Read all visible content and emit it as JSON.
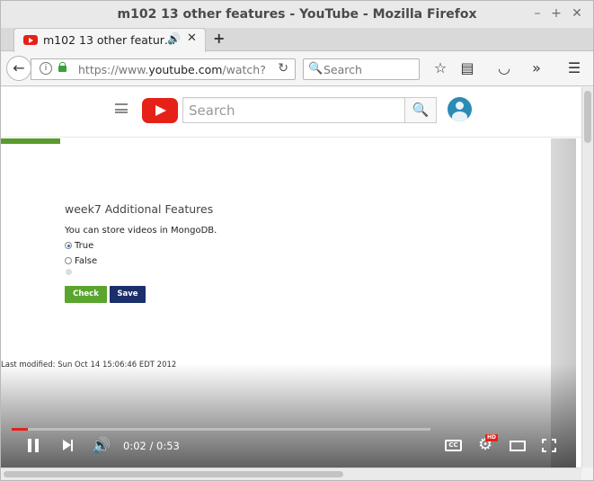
{
  "window": {
    "title": "m102 13 other features - YouTube - Mozilla Firefox",
    "minimize": "–",
    "maximize": "+",
    "close": "✕"
  },
  "tab": {
    "title": "m102 13 other featur…",
    "audio_icon": "🔊",
    "close": "✕",
    "new_tab": "+"
  },
  "navbar": {
    "back": "←",
    "info": "i",
    "url_prefix": "https://www.",
    "url_domain": "youtube.com",
    "url_suffix": "/watch?",
    "reload": "↻",
    "search_placeholder": "Search",
    "search_icon": "🔍",
    "icons": [
      "star-icon",
      "reader-icon",
      "pocket-icon",
      "overflow-icon",
      "menu-icon"
    ],
    "star": "☆",
    "reader": "▤",
    "pocket": "◡",
    "overflow": "»",
    "menu": "☰"
  },
  "youtube": {
    "search_placeholder": "Search",
    "search_btn": "🔍"
  },
  "slide": {
    "title": "week7 Additional Features",
    "question": "You can store videos in MongoDB.",
    "options": [
      {
        "label": "True",
        "selected": true
      },
      {
        "label": "False",
        "selected": false
      }
    ],
    "check_label": "Check",
    "save_label": "Save",
    "last_modified": "Last modified: Sun Oct 14 15:06:46 EDT 2012"
  },
  "player": {
    "current_time": "0:02",
    "duration": "0:53",
    "time_display": "0:02 / 0:53",
    "progress_fraction": 0.0377,
    "volume_icon": "🔊",
    "cc_label": "CC",
    "settings_icon": "⚙",
    "hd_badge": "HD"
  },
  "colors": {
    "youtube_red": "#e62117",
    "check_green": "#5aa52d",
    "save_navy": "#1b2f6a"
  }
}
